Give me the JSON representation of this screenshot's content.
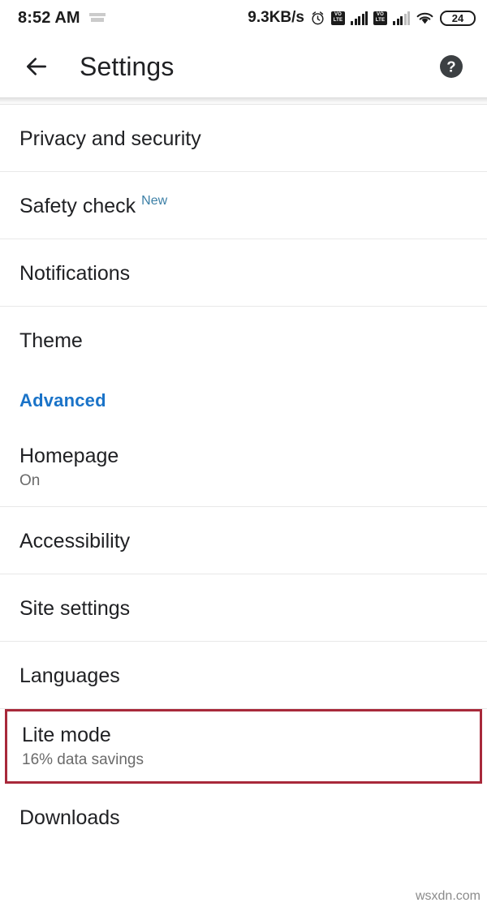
{
  "status_bar": {
    "time": "8:52 AM",
    "tray_icon": "notification-tray-icon",
    "network_speed": "9.3KB/s",
    "alarm_icon": "alarm-clock-icon",
    "sim1": {
      "label_top": "VO",
      "label_bottom": "LTE",
      "signal_icon": "signal-bars-icon"
    },
    "sim2": {
      "label_top": "VO",
      "label_bottom": "LTE",
      "signal_icon": "signal-bars-icon"
    },
    "wifi_icon": "wifi-icon",
    "battery_level": "24"
  },
  "app_bar": {
    "back_icon": "back-arrow-icon",
    "title": "Settings",
    "help_icon": "help-circle-icon"
  },
  "settings": {
    "rows": [
      {
        "title": "Privacy and security",
        "subtitle": "",
        "badge": "",
        "type": "single",
        "divider": true,
        "highlighted": false
      },
      {
        "title": "Safety check",
        "subtitle": "",
        "badge": "New",
        "type": "single",
        "divider": true,
        "highlighted": false
      },
      {
        "title": "Notifications",
        "subtitle": "",
        "badge": "",
        "type": "single",
        "divider": true,
        "highlighted": false
      },
      {
        "title": "Theme",
        "subtitle": "",
        "badge": "",
        "type": "single",
        "divider": false,
        "highlighted": false
      }
    ],
    "section_header": "Advanced",
    "advanced_rows": [
      {
        "title": "Homepage",
        "subtitle": "On",
        "badge": "",
        "type": "double",
        "divider": true,
        "highlighted": false
      },
      {
        "title": "Accessibility",
        "subtitle": "",
        "badge": "",
        "type": "single",
        "divider": true,
        "highlighted": false
      },
      {
        "title": "Site settings",
        "subtitle": "",
        "badge": "",
        "type": "single",
        "divider": true,
        "highlighted": false
      },
      {
        "title": "Languages",
        "subtitle": "",
        "badge": "",
        "type": "single",
        "divider": true,
        "highlighted": false
      },
      {
        "title": "Lite mode",
        "subtitle": "16% data savings",
        "badge": "",
        "type": "double",
        "divider": false,
        "highlighted": true
      },
      {
        "title": "Downloads",
        "subtitle": "",
        "badge": "",
        "type": "single",
        "divider": false,
        "highlighted": false
      }
    ]
  },
  "colors": {
    "accent_blue": "#1a73c8",
    "badge_blue": "#3b7fa6",
    "highlight_red": "#a8293a",
    "text_primary": "#202124",
    "text_secondary": "#6a6a6a"
  },
  "watermark": "wsxdn.com"
}
